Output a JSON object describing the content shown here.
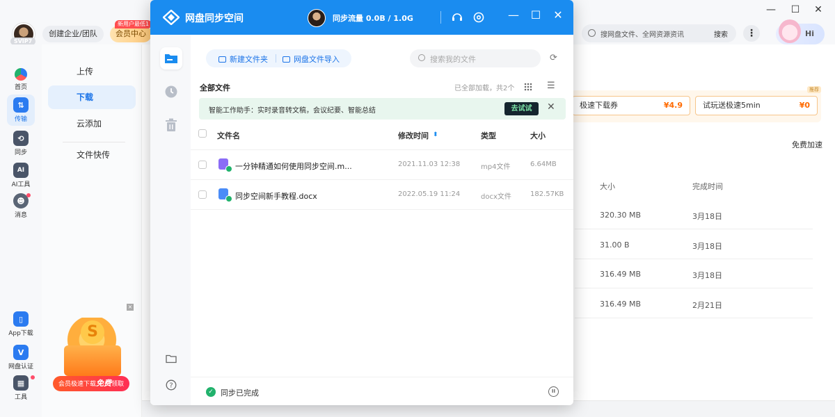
{
  "main": {
    "svip_badge": "SVIP7",
    "team_button": "创建企业/团队",
    "vip_button": "会员中心",
    "vip_tag": "新用户最低1",
    "search_placeholder": "搜网盘文件、全网资源资讯",
    "search_button": "搜索",
    "hi_label": "Hi",
    "window_controls": [
      "—",
      "☐",
      "✕"
    ]
  },
  "iconbar": {
    "items": [
      {
        "label": "首页",
        "icon": "home-icon"
      },
      {
        "label": "传输",
        "icon": "transfer-icon"
      },
      {
        "label": "同步",
        "icon": "sync-icon"
      },
      {
        "label": "AI工具",
        "icon": "ai-icon"
      },
      {
        "label": "消息",
        "icon": "message-icon"
      },
      {
        "label": "App下载",
        "icon": "phone-icon"
      },
      {
        "label": "网盘认证",
        "icon": "verify-icon"
      },
      {
        "label": "工具",
        "icon": "tools-icon"
      }
    ]
  },
  "subnav": {
    "items": [
      "上传",
      "下载",
      "云添加",
      "文件快传"
    ],
    "active": "下载"
  },
  "promo": {
    "cta_prefix": "会员极速下载",
    "cta_bold": "免费",
    "cta_suffix": "领取",
    "close": "×"
  },
  "background": {
    "coupons": [
      {
        "label": "极速下载券",
        "price": "¥4.9"
      },
      {
        "label": "试玩送极速5min",
        "price": "¥0"
      }
    ],
    "rec_tag": "推荐",
    "free_accel": "免费加速",
    "table_headers": [
      "大小",
      "完成时间"
    ],
    "rows": [
      {
        "size": "320.30 MB",
        "date": "3月18日"
      },
      {
        "size": "31.00 B",
        "date": "3月18日"
      },
      {
        "size": "316.49 MB",
        "date": "3月18日"
      },
      {
        "size": "316.49 MB",
        "date": "2月21日"
      }
    ]
  },
  "dialog": {
    "title": "网盘同步空间",
    "quota": "同步流量 0.0B / 1.0G",
    "colors": {
      "header": "#1a8cf0",
      "success": "#21b26c"
    },
    "toolbar": {
      "new_folder": "新建文件夹",
      "import": "网盘文件导入"
    },
    "search_placeholder": "搜索我的文件",
    "breadcrumb": "全部文件",
    "loaded_text": "已全部加载，共2个",
    "banner": {
      "text": "智能工作助手：实时录音转文稿，会议纪要、智能总结",
      "button": "去试试",
      "close": "✕"
    },
    "columns": [
      "文件名",
      "修改时间",
      "类型",
      "大小"
    ],
    "sort_indicator": "⬍",
    "files": [
      {
        "name": "一分钟精通如何使用同步空间.m...",
        "time": "2021.11.03 12:38",
        "type": "mp4文件",
        "size": "6.64MB",
        "icon": "video-file-icon",
        "color": "#8b6cf6"
      },
      {
        "name": "同步空间新手教程.docx",
        "time": "2022.05.19 11:24",
        "type": "docx文件",
        "size": "182.57KB",
        "icon": "word-file-icon",
        "color": "#4a8cf7"
      }
    ],
    "footer_status": "同步已完成",
    "header_controls": [
      "—",
      "☐",
      "✕"
    ]
  }
}
